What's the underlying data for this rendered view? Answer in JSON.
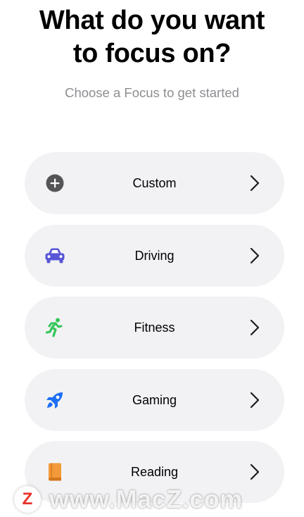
{
  "header": {
    "title_line1": "What do you want",
    "title_line2": "to focus on?",
    "subtitle": "Choose a Focus to get started"
  },
  "focus_options": [
    {
      "label": "Custom",
      "icon": "plus-circle-icon",
      "color": "#545458"
    },
    {
      "label": "Driving",
      "icon": "car-icon",
      "color": "#5856d6"
    },
    {
      "label": "Fitness",
      "icon": "running-figure-icon",
      "color": "#34c759"
    },
    {
      "label": "Gaming",
      "icon": "rocket-icon",
      "color": "#1c6ef5"
    },
    {
      "label": "Reading",
      "icon": "book-icon",
      "color": "#f29a3a"
    }
  ],
  "watermark": {
    "badge": "Z",
    "text": "www.MacZ.com",
    "badge_color": "#e8322c"
  }
}
